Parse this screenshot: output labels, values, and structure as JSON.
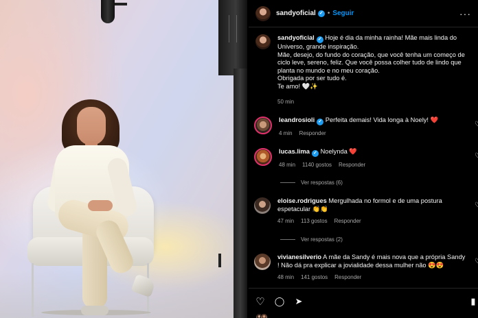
{
  "post": {
    "username": "sandyoficial",
    "separator": "•",
    "follow_label": "Seguir",
    "more_label": "···",
    "caption_lines": [
      "Hoje é dia da minha rainha! Mãe mais linda do Universo, grande inspiração.",
      "Mãe, desejo, do fundo do coração, que você tenha um começo de ciclo leve, sereno, feliz. Que você possa colher tudo de lindo que planta no mundo e no meu coração.",
      "Obrigada por ser tudo é.",
      "Te amo! 🤍✨"
    ],
    "caption_time": "50 min"
  },
  "comments": [
    {
      "username": "leandrosioli",
      "verified": true,
      "text": "Perfeita demais! Vida longa à Noely! ❤️",
      "time": "4 min",
      "likes": "",
      "reply_label": "Responder"
    },
    {
      "username": "lucas.lima",
      "verified": true,
      "text": "Noelynda ❤️",
      "time": "48 min",
      "likes": "1140 gostos",
      "reply_label": "Responder",
      "view_replies": "Ver respostas (6)"
    },
    {
      "username": "eloise.rodrigues",
      "verified": false,
      "text": "Mergulhada no formol e de uma postura espetacular 👏👏",
      "time": "47 min",
      "likes": "113 gostos",
      "reply_label": "Responder",
      "view_replies": "Ver respostas (2)"
    },
    {
      "username": "vivianesilverio",
      "verified": false,
      "text": "A mãe da Sandy é mais nova que a própria Sandy ! Não dá pra explicar a jovialidade dessa mulher não 😍😍",
      "time": "48 min",
      "likes": "141 gostos",
      "reply_label": "Responder"
    }
  ],
  "icons": {
    "like": "♡",
    "comment": "◯",
    "share": "➤",
    "save": "▮",
    "verified": "✓",
    "heart_small": "♡"
  },
  "colors": {
    "accent": "#0095f6",
    "verified": "#1d9bf0",
    "background": "#000000",
    "muted_text": "#a8a8a8"
  }
}
